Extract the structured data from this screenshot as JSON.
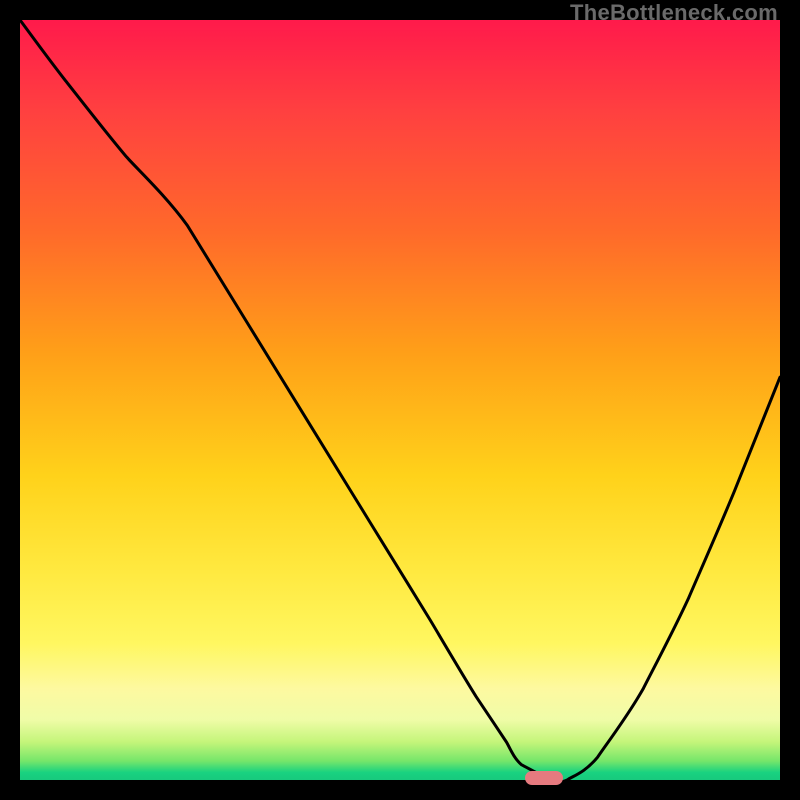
{
  "watermark": "TheBottleneck.com",
  "colors": {
    "curve_stroke": "#000000",
    "marker_fill": "#e67a7f",
    "frame_background": "#000000"
  },
  "chart_data": {
    "type": "line",
    "title": "",
    "xlabel": "",
    "ylabel": "",
    "xlim": [
      0,
      100
    ],
    "ylim": [
      0,
      100
    ],
    "grid": false,
    "legend": false,
    "series": [
      {
        "name": "bottleneck-curve",
        "x": [
          0,
          6,
          14,
          22,
          30,
          38,
          46,
          54,
          60,
          64,
          66,
          70,
          72,
          76,
          82,
          88,
          94,
          100
        ],
        "y": [
          100,
          92,
          82,
          73,
          60,
          47,
          34,
          21,
          11,
          5,
          2,
          0,
          0,
          3,
          12,
          24,
          38,
          53
        ]
      }
    ],
    "annotations": [
      {
        "name": "optimal-marker",
        "type": "pill",
        "x": 69,
        "y": 0,
        "width_pct": 5,
        "color": "#e67a7f"
      }
    ]
  }
}
